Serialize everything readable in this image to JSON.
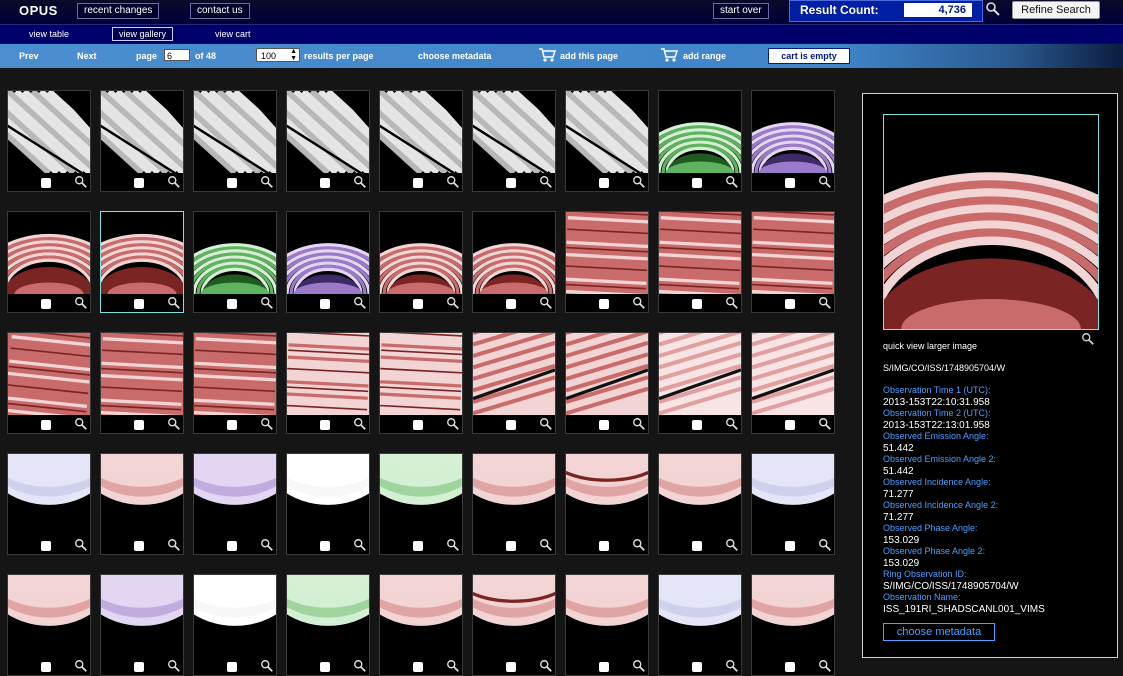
{
  "header": {
    "logo": "OPUS",
    "links": [
      "recent changes",
      "contact us"
    ],
    "start_over": "start over",
    "result_count_label": "Result Count:",
    "result_count": "4,736",
    "refine_label": "Refine Search"
  },
  "views": {
    "table": "view table",
    "gallery": "view gallery",
    "cart": "view cart"
  },
  "nav": {
    "prev": "Prev",
    "next": "Next",
    "page_label": "page",
    "page": "6",
    "of_label": "of 48",
    "per_page": "100",
    "per_page_label": "results per page",
    "choose_metadata": "choose metadata",
    "add_page": "add this page",
    "add_range": "add range",
    "cart_status": "cart is empty"
  },
  "gallery": {
    "rows": [
      [
        "rings_gray",
        "rings_gray",
        "rings_gray",
        "rings_gray",
        "rings_gray",
        "rings_gray",
        "rings_gray",
        "arc_green",
        "arc_purple"
      ],
      [
        "arc_red_big",
        "arc_red_big",
        "arc_green_bright",
        "arc_purple_bright",
        "arc_red_thin",
        "arc_red_thin",
        "stripes_red",
        "stripes_red",
        "stripes_red"
      ],
      [
        "stripes_red_dark",
        "stripes_red",
        "stripes_red",
        "stripes_red_light",
        "stripes_red_light",
        "diag_red",
        "diag_red",
        "diag_pink",
        "diag_pink"
      ],
      [
        "planet_blue",
        "planet_red",
        "planet_purple",
        "planet_white",
        "planet_green",
        "planet_red",
        "planet_red_band",
        "planet_red",
        "planet_blue"
      ],
      [
        "planet_red",
        "planet_purple",
        "planet_white",
        "planet_green",
        "planet_red",
        "planet_red_band",
        "planet_red",
        "planet_blue",
        "planet_red"
      ]
    ],
    "selected_index": 10
  },
  "preview": {
    "quick_view_label": "quick view larger image",
    "obs_id": "S/IMG/CO/ISS/1748905704/W",
    "metadata": [
      {
        "label": "Observation Time 1 (UTC):",
        "value": "2013-153T22:10:31.958"
      },
      {
        "label": "Observation Time 2 (UTC):",
        "value": "2013-153T22:13:01.958"
      },
      {
        "label": "Observed Emission Angle:",
        "value": "51.442"
      },
      {
        "label": "Observed Emission Angle 2:",
        "value": "51.442"
      },
      {
        "label": "Observed Incidence Angle:",
        "value": "71.277"
      },
      {
        "label": "Observed Incidence Angle 2:",
        "value": "71.277"
      },
      {
        "label": "Observed Phase Angle:",
        "value": "153.029"
      },
      {
        "label": "Observed Phase Angle 2:",
        "value": "153.029"
      },
      {
        "label": "Ring Observation ID:",
        "value": "S/IMG/CO/ISS/1748905704/W"
      },
      {
        "label": "Observation Name:",
        "value": "ISS_191RI_SHADSCANL001_VIMS"
      }
    ],
    "choose_metadata": "choose metadata"
  },
  "icons": {
    "zoom": "magnifier-icon",
    "cart": "cart-icon"
  }
}
